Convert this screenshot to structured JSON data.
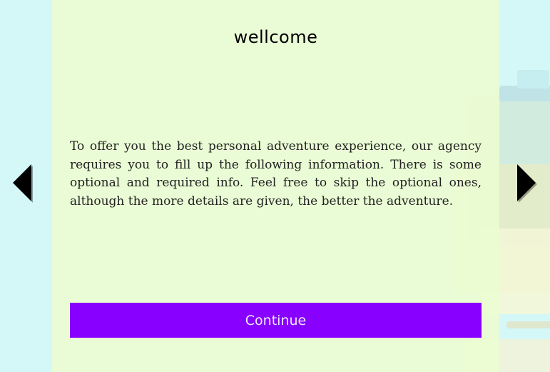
{
  "header": {
    "title": "wellcome"
  },
  "intro": {
    "message": "To offer you the best personal adventure experience, our agency requires you to fill up the following information. There is some optional and required info. Feel free to skip the optional ones, although the more details are given, the better the adventure."
  },
  "actions": {
    "continue_label": "Continue"
  },
  "icons": {
    "prev": "arrow-left-icon",
    "next": "arrow-right-icon"
  },
  "colors": {
    "background": "#d4f8f8",
    "panel": "#ecfcd2",
    "button": "#8800ff",
    "arrow": "#000000"
  }
}
